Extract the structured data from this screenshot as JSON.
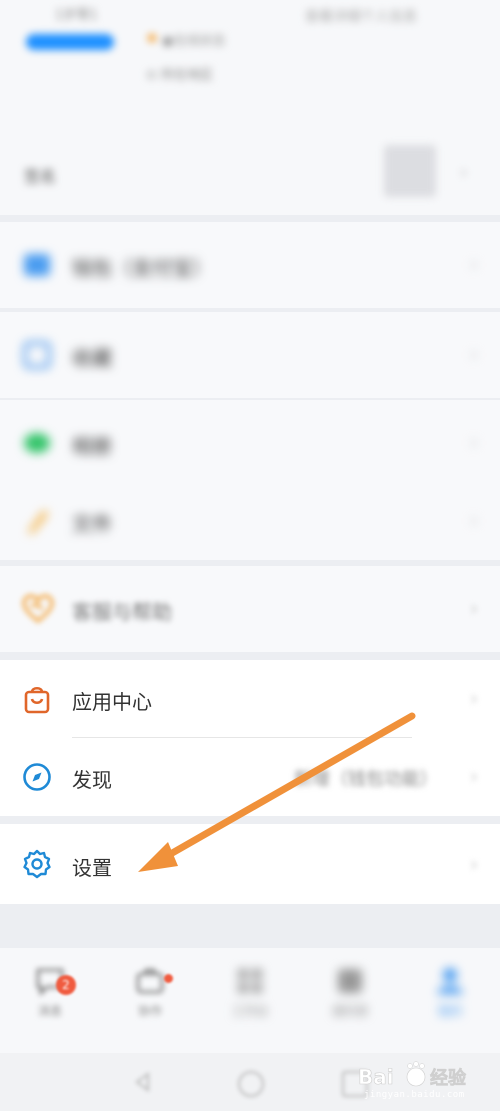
{
  "profile": {
    "name_top": "1岁零1",
    "status": "●在线状态",
    "address": "⊙ 所在地区",
    "right_top": "查看详细个人信息",
    "signature": "签名",
    "qr_label": "二维码",
    "chevron": "›"
  },
  "menu": {
    "wallet": {
      "label": "钱包（支付宝）",
      "icon": "wallet-icon"
    },
    "favorites": {
      "label": "收藏",
      "icon": "favorites-icon"
    },
    "album": {
      "label": "相册",
      "icon": "album-icon"
    },
    "files": {
      "label": "文件",
      "icon": "files-icon"
    },
    "service": {
      "label": "客服与帮助",
      "icon": "heart-handshake-icon"
    },
    "app_center": {
      "label": "应用中心",
      "icon": "shopping-bag-icon"
    },
    "discover": {
      "label": "发现",
      "extra": "新增（钱包功能）",
      "icon": "compass-icon"
    },
    "settings": {
      "label": "设置",
      "icon": "gear-icon"
    }
  },
  "tabbar": {
    "tabs": [
      {
        "label": "消息",
        "badge": "2"
      },
      {
        "label": "协作"
      },
      {
        "label": "工作台"
      },
      {
        "label": "通讯录"
      },
      {
        "label": "我的"
      }
    ]
  },
  "watermark": {
    "text": "Bai",
    "text2": "经验",
    "url": "jingyan.baidu.com"
  },
  "colors": {
    "accent": "#1e90ff",
    "orange_icon": "#e0662a",
    "blue_icon": "#1f8ad6",
    "arrow": "#f0913a",
    "badge": "#f05b3f"
  }
}
